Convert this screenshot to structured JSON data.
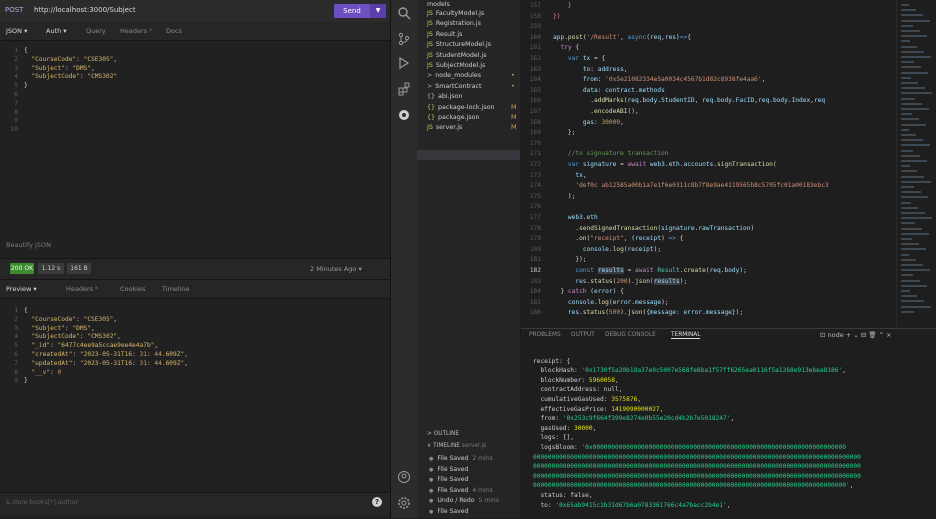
{
  "insomnia": {
    "method": "POST",
    "url": "http://localhost:3000/Subject",
    "send_label": "Send",
    "send_dropdown": "▼",
    "req_tabs": [
      {
        "label": "JSON ▾"
      },
      {
        "label": "Auth ▾"
      },
      {
        "label": "Query"
      },
      {
        "label": "Headers ⁵"
      },
      {
        "label": "Docs"
      }
    ],
    "req_lines": [
      {
        "n": "1",
        "text": "{"
      },
      {
        "n": "2",
        "text": "  \"CourseCode\": \"CSE305\","
      },
      {
        "n": "3",
        "text": "  \"Subject\": \"DMS\","
      },
      {
        "n": "4",
        "text": "  \"SubjectCode\": \"CMS302\""
      },
      {
        "n": "5",
        "text": "}"
      },
      {
        "n": "6",
        "text": ""
      },
      {
        "n": "7",
        "text": ""
      },
      {
        "n": "8",
        "text": ""
      },
      {
        "n": "9",
        "text": ""
      },
      {
        "n": "10",
        "text": ""
      }
    ],
    "beautify_label": "Beautify JSON",
    "status": "200 OK",
    "time": "1.12 s",
    "size": "161 B",
    "age": "2 Minutes Ago ▾",
    "resp_tabs": [
      {
        "label": "Preview ▾"
      },
      {
        "label": "Headers ⁸"
      },
      {
        "label": "Cookies"
      },
      {
        "label": "Timeline"
      }
    ],
    "resp_lines": [
      {
        "n": "1",
        "text": "{"
      },
      {
        "n": "2",
        "text": "  \"CourseCode\": \"CSE305\","
      },
      {
        "n": "3",
        "text": "  \"Subject\": \"DMS\","
      },
      {
        "n": "4",
        "text": "  \"SubjectCode\": \"CMS302\","
      },
      {
        "n": "5",
        "text": "  \"_id\": \"6477c4ee9a5ccae9ee4e4a7b\","
      },
      {
        "n": "6",
        "text": "  \"createdAt\": \"2023-05-31T16:31:44.609Z\","
      },
      {
        "n": "7",
        "text": "  \"updatedAt\": \"2023-05-31T16:31:44.609Z\","
      },
      {
        "n": "8",
        "text": "  \"__v\": 0"
      },
      {
        "n": "9",
        "text": "}"
      }
    ],
    "filter_placeholder": "$.store.books[*].author",
    "help_icon": "?"
  },
  "activity": {
    "icons": [
      "search-icon",
      "source-control-icon",
      "run-debug-icon",
      "extensions-icon",
      "remote-icon",
      "account-icon",
      "settings-icon"
    ]
  },
  "explorer": {
    "top_item": "models",
    "files": [
      {
        "icon": "JS",
        "label": "FacultyModel.js",
        "mark": ""
      },
      {
        "icon": "JS",
        "label": "Registration.js",
        "mark": ""
      },
      {
        "icon": "JS",
        "label": "Result.js",
        "mark": ""
      },
      {
        "icon": "JS",
        "label": "StructureModel.js",
        "mark": ""
      },
      {
        "icon": "JS",
        "label": "StudentModel.js",
        "mark": ""
      },
      {
        "icon": "JS",
        "label": "SubjectModel.js",
        "mark": ""
      },
      {
        "icon": ">",
        "label": "node_modules",
        "mark": "•"
      },
      {
        "icon": ">",
        "label": "SmartContract",
        "mark": "•"
      },
      {
        "icon": "{}",
        "label": "abi.json",
        "mark": ""
      },
      {
        "icon": "{}",
        "label": "package-lock.json",
        "mark": "M"
      },
      {
        "icon": "{}",
        "label": "package.json",
        "mark": "M"
      },
      {
        "icon": "JS",
        "label": "server.js",
        "mark": "M"
      }
    ],
    "outline_label": "> OUTLINE",
    "timeline_label": "∨ TIMELINE",
    "timeline_file": "server.js",
    "timeline": [
      {
        "label": "File Saved",
        "time": "2 mins"
      },
      {
        "label": "File Saved",
        "time": ""
      },
      {
        "label": "File Saved",
        "time": ""
      },
      {
        "label": "File Saved",
        "time": "4 mins"
      },
      {
        "label": "Undo / Redo",
        "time": "5 mins"
      },
      {
        "label": "File Saved",
        "time": ""
      }
    ]
  },
  "editor": {
    "lines": [
      {
        "n": "157",
        "html": "    <span class='k2'>}</span>"
      },
      {
        "n": "158",
        "html": "<span class='k2'>})</span>"
      },
      {
        "n": "159",
        "html": ""
      },
      {
        "n": "160",
        "html": "<span class='v'>app</span>.<span class='fn'>post</span>(<span class='s'>'/Result'</span>, <span class='kw'>async</span>(<span class='v'>req</span>,<span class='v'>res</span>)<span class='kw'>=></span>{"
      },
      {
        "n": "161",
        "html": "  <span class='k2'>try</span> {"
      },
      {
        "n": "162",
        "html": "    <span class='kw'>var</span> <span class='v'>tx</span> = {"
      },
      {
        "n": "163",
        "html": "        <span class='v'>to</span>: <span class='v'>address</span>,"
      },
      {
        "n": "164",
        "html": "        <span class='v'>from</span>: <span class='s'>'0x5e21082334e5a0034c4567b1d82c8938fe4aa6'</span>,"
      },
      {
        "n": "165",
        "html": "        <span class='v'>data</span>: <span class='v'>contract</span>.<span class='v'>methods</span>"
      },
      {
        "n": "166",
        "html": "          .<span class='fn'>addMarks</span>(<span class='v'>req</span>.<span class='v'>body</span>.<span class='v'>StudentID</span>, <span class='v'>req</span>.<span class='v'>body</span>.<span class='v'>FacID</span>,<span class='v'>req</span>.<span class='v'>body</span>.<span class='v'>Index</span>,<span class='v'>req</span>"
      },
      {
        "n": "167",
        "html": "          .<span class='fn'>encodeABI</span>(),"
      },
      {
        "n": "168",
        "html": "        <span class='v'>gas</span>: <span class='num'>30000</span>,"
      },
      {
        "n": "169",
        "html": "    };"
      },
      {
        "n": "170",
        "html": ""
      },
      {
        "n": "171",
        "html": "    <span class='cm'>//to signuature transaction</span>"
      },
      {
        "n": "172",
        "html": "    <span class='kw'>var</span> <span class='v'>signature</span> = <span class='k2'>await</span> <span class='v'>web3</span>.<span class='v'>eth</span>.<span class='v'>accounts</span>.<span class='fn'>signTransaction</span>("
      },
      {
        "n": "173",
        "html": "      <span class='v'>tx</span>,"
      },
      {
        "n": "174",
        "html": "      <span class='s'>'def0c ab12585a00b1a7e1f6e0311c8b7f8e9ae4119565b8c5705fc01a00183ebc3</span>"
      },
      {
        "n": "175",
        "html": "    );"
      },
      {
        "n": "176",
        "html": ""
      },
      {
        "n": "177",
        "html": "    <span class='v'>web3</span>.<span class='v'>eth</span>"
      },
      {
        "n": "178",
        "html": "      .<span class='fn'>sendSignedTransaction</span>(<span class='v'>signature</span>.<span class='v'>rawTransaction</span>)"
      },
      {
        "n": "179",
        "html": "      .<span class='fn'>on</span>(<span class='s'>\"receipt\"</span>, (<span class='v'>receipt</span>) <span class='kw'>=></span> {"
      },
      {
        "n": "180",
        "html": "        <span class='v'>console</span>.<span class='fn'>log</span>(<span class='v'>receipt</span>);"
      },
      {
        "n": "181",
        "html": "      });"
      },
      {
        "n": "182",
        "html": "      <span class='kw'>const</span> <span class='v hl'>results</span> = <span class='k2'>await</span> <span class='cls'>Result</span>.<span class='fn'>create</span>(<span class='v'>req</span>.<span class='v'>body</span>);"
      },
      {
        "n": "183",
        "html": "      <span class='v'>res</span>.<span class='fn'>status</span>(<span class='num'>200</span>).<span class='fn'>json</span>(<span class='v hl'>results</span>);"
      },
      {
        "n": "184",
        "html": "  } <span class='k2'>catch</span> (<span class='v'>error</span>) {"
      },
      {
        "n": "185",
        "html": "    <span class='v'>console</span>.<span class='fn'>log</span>(<span class='v'>error</span>.<span class='v'>message</span>);"
      },
      {
        "n": "186",
        "html": "    <span class='v'>res</span>.<span class='fn'>status</span>(<span class='num'>500</span>).<span class='fn'>json</span>({<span class='v'>message</span>: <span class='v'>error</span>.<span class='v'>message</span>});"
      }
    ]
  },
  "panel": {
    "tabs": [
      {
        "label": "PROBLEMS"
      },
      {
        "label": "OUTPUT"
      },
      {
        "label": "DEBUG CONSOLE"
      },
      {
        "label": "TERMINAL"
      }
    ],
    "actions": "⊡ node  +  ⌄  ⊟  🗑  ⌃  ×",
    "terminal": [
      {
        "html": ""
      },
      {
        "html": "receipt: {"
      },
      {
        "html": "  blockHash: <span class='tg'>'0x1730f5a20b18a37e0c5007e568fe8ba1f57ff6265ea0116f5a1268e913ebea8186'</span>,"
      },
      {
        "html": "  blockNumber: <span class='ty'>5960058</span>,"
      },
      {
        "html": "  contractAddress: null,"
      },
      {
        "html": "  cumulativeGasUsed: <span class='ty'>3575876</span>,"
      },
      {
        "html": "  effectiveGasPrice: <span class='ty'>1419090000027</span>,"
      },
      {
        "html": "  from: <span class='tg'>'0x253c9f664f399e8274e0b55e20cd4b2b7e5018247'</span>,"
      },
      {
        "html": "  gasUsed: <span class='ty'>30000</span>,"
      },
      {
        "html": "  logs: [],"
      },
      {
        "html": "  logsBloom: <span class='tg'>'0x00000000000000000000000000000000000000000000000000000000000000000000</span>"
      },
      {
        "html": "<span class='tg'>0000000000000000000000000000000000000000000000000000000000000000000000000000000000000000</span>"
      },
      {
        "html": "<span class='tg'>0000000000000000000000000000000000000000000000000000000000000000000000000000000000000000</span>"
      },
      {
        "html": "<span class='tg'>0000000000000000000000000000000000000000000000000000000000000000000000000000000000000000</span>"
      },
      {
        "html": "<span class='tg'>000000000000000000000000000000000000000000000000000000000000000000000000000000000000'</span>,"
      },
      {
        "html": "  status: false,"
      },
      {
        "html": "  to: <span class='tg'>'0x65ab9415c1b31d67b6a0783361766c4a7bacc2b4e1'</span>,"
      }
    ]
  }
}
